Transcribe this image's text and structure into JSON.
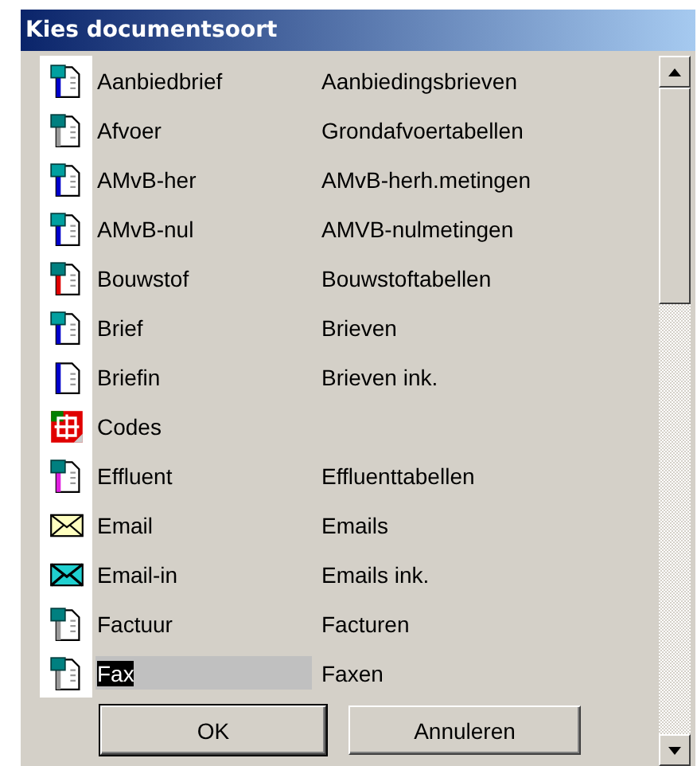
{
  "window": {
    "title": "Kies documentsoort"
  },
  "rows": [
    {
      "kind": "word",
      "name": "Aanbiedbrief",
      "description": "Aanbiedingsbrieven",
      "selected": false
    },
    {
      "kind": "excel",
      "name": "Afvoer",
      "description": "Grondafvoertabellen",
      "selected": false
    },
    {
      "kind": "word",
      "name": "AMvB-her",
      "description": "AMvB-herh.metingen",
      "selected": false
    },
    {
      "kind": "word",
      "name": "AMvB-nul",
      "description": "AMVB-nulmetingen",
      "selected": false
    },
    {
      "kind": "excel-red",
      "name": "Bouwstof",
      "description": "Bouwstoftabellen",
      "selected": false
    },
    {
      "kind": "word",
      "name": "Brief",
      "description": "Brieven",
      "selected": false
    },
    {
      "kind": "doc-blue",
      "name": "Briefin",
      "description": "Brieven ink.",
      "selected": false
    },
    {
      "kind": "codes",
      "name": "Codes",
      "selected": false
    },
    {
      "kind": "excel-pink",
      "name": "Effluent",
      "description": "Effluenttabellen",
      "selected": false
    },
    {
      "kind": "mail",
      "name": "Email",
      "description": "Emails",
      "selected": false
    },
    {
      "kind": "mail-in",
      "name": "Email-in",
      "description": "Emails ink.",
      "selected": false
    },
    {
      "kind": "word-plain",
      "name": "Factuur",
      "description": "Facturen",
      "selected": false
    },
    {
      "kind": "word-plain",
      "name": "Fax",
      "description": "Faxen",
      "selected": true
    }
  ],
  "buttons": [
    {
      "label": "OK",
      "default": true
    },
    {
      "label": "Annuleren",
      "default": false
    }
  ]
}
